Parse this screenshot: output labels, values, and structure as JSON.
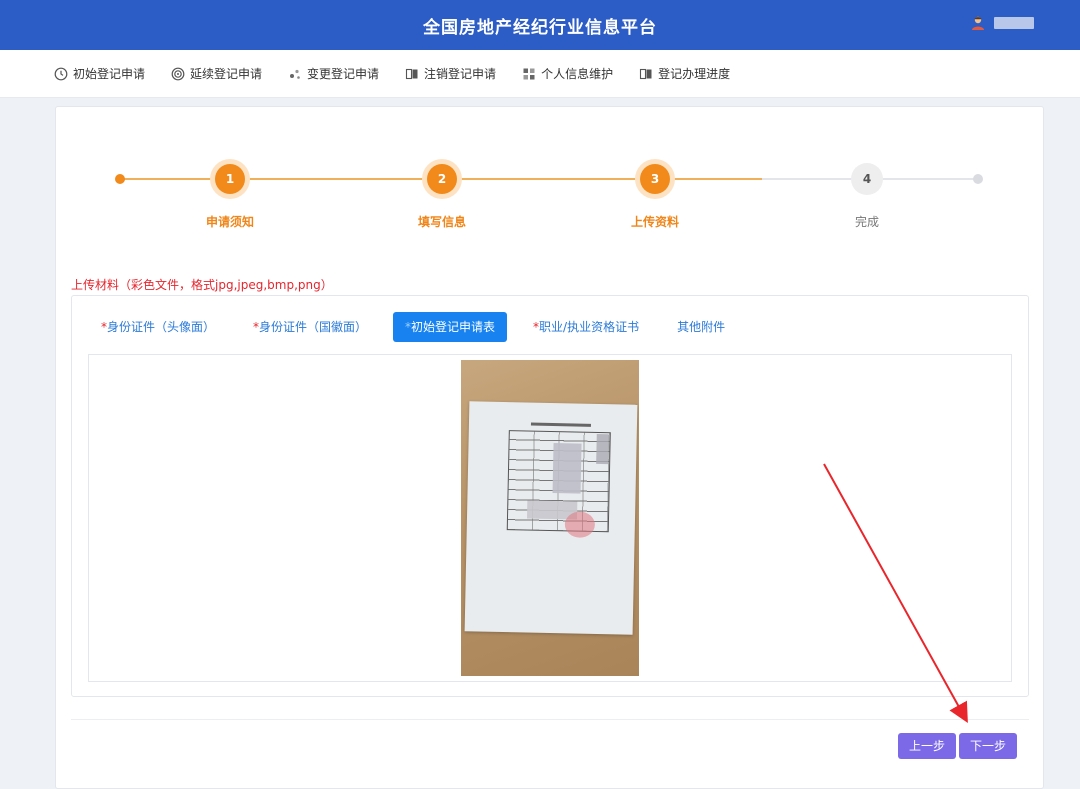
{
  "header": {
    "title": "全国房地产经纪行业信息平台"
  },
  "nav": {
    "items": [
      {
        "label": "初始登记申请",
        "icon": "clock-icon"
      },
      {
        "label": "延续登记申请",
        "icon": "target-icon"
      },
      {
        "label": "变更登记申请",
        "icon": "dots-icon"
      },
      {
        "label": "注销登记申请",
        "icon": "book-icon"
      },
      {
        "label": "个人信息维护",
        "icon": "grid-icon"
      },
      {
        "label": "登记办理进度",
        "icon": "book-icon"
      }
    ]
  },
  "steps": {
    "items": [
      {
        "number": "1",
        "label": "申请须知",
        "state": "done"
      },
      {
        "number": "2",
        "label": "填写信息",
        "state": "done"
      },
      {
        "number": "3",
        "label": "上传资料",
        "state": "current"
      },
      {
        "number": "4",
        "label": "完成",
        "state": "todo"
      }
    ]
  },
  "upload": {
    "note": "上传材料（彩色文件，格式jpg,jpeg,bmp,png）",
    "tabs": [
      {
        "req": "*",
        "label": "身份证件（头像面）",
        "active": false
      },
      {
        "req": "*",
        "label": "身份证件（国徽面）",
        "active": false
      },
      {
        "req": "*",
        "label": "初始登记申请表",
        "active": true
      },
      {
        "req": "*",
        "label": "职业/执业资格证书",
        "active": false
      },
      {
        "req": "",
        "label": "其他附件",
        "active": false
      }
    ]
  },
  "buttons": {
    "prev": "上一步",
    "next": "下一步"
  },
  "colors": {
    "header_bg": "#2c5cc5",
    "step_active": "#f18a1b",
    "tab_active": "#1782f0",
    "button": "#7b69e8",
    "required": "#e5262e",
    "annotation_arrow": "#e8262b"
  }
}
